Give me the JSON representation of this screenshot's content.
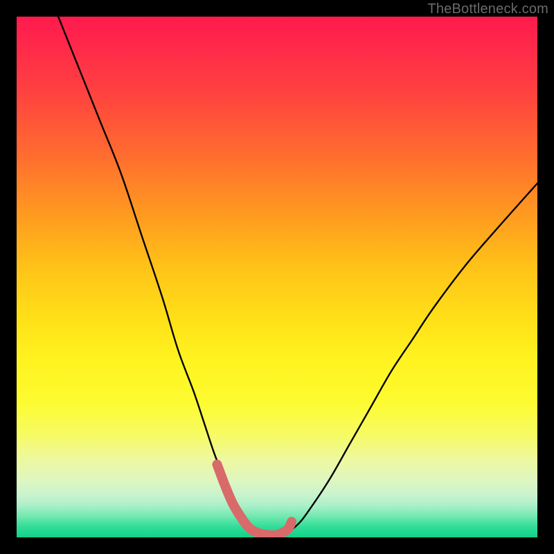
{
  "watermark": "TheBottleneck.com",
  "chart_data": {
    "type": "line",
    "title": "",
    "xlabel": "",
    "ylabel": "",
    "xlim": [
      0,
      100
    ],
    "ylim": [
      0,
      100
    ],
    "series": [
      {
        "name": "bottleneck-curve",
        "color": "#000000",
        "x": [
          8,
          12,
          16,
          20,
          24,
          28,
          31,
          34,
          36,
          38,
          40,
          41.5,
          43,
          44.5,
          46,
          48,
          50,
          52,
          54,
          56,
          60,
          64,
          68,
          72,
          76,
          80,
          86,
          92,
          100
        ],
        "y": [
          100,
          90,
          80,
          70,
          58,
          46,
          36,
          28,
          22,
          16,
          11,
          7,
          4,
          2,
          1,
          0.5,
          0.5,
          1,
          2.5,
          5,
          11,
          18,
          25,
          32,
          38,
          44,
          52,
          59,
          68
        ]
      },
      {
        "name": "highlight-band",
        "color": "#d86a6a",
        "x": [
          38.5,
          40,
          41.5,
          43,
          44.5,
          46,
          48,
          50,
          52,
          52.8
        ],
        "y": [
          14,
          10,
          6.5,
          4,
          2,
          1,
          0.5,
          0.5,
          1.5,
          3
        ]
      }
    ]
  }
}
